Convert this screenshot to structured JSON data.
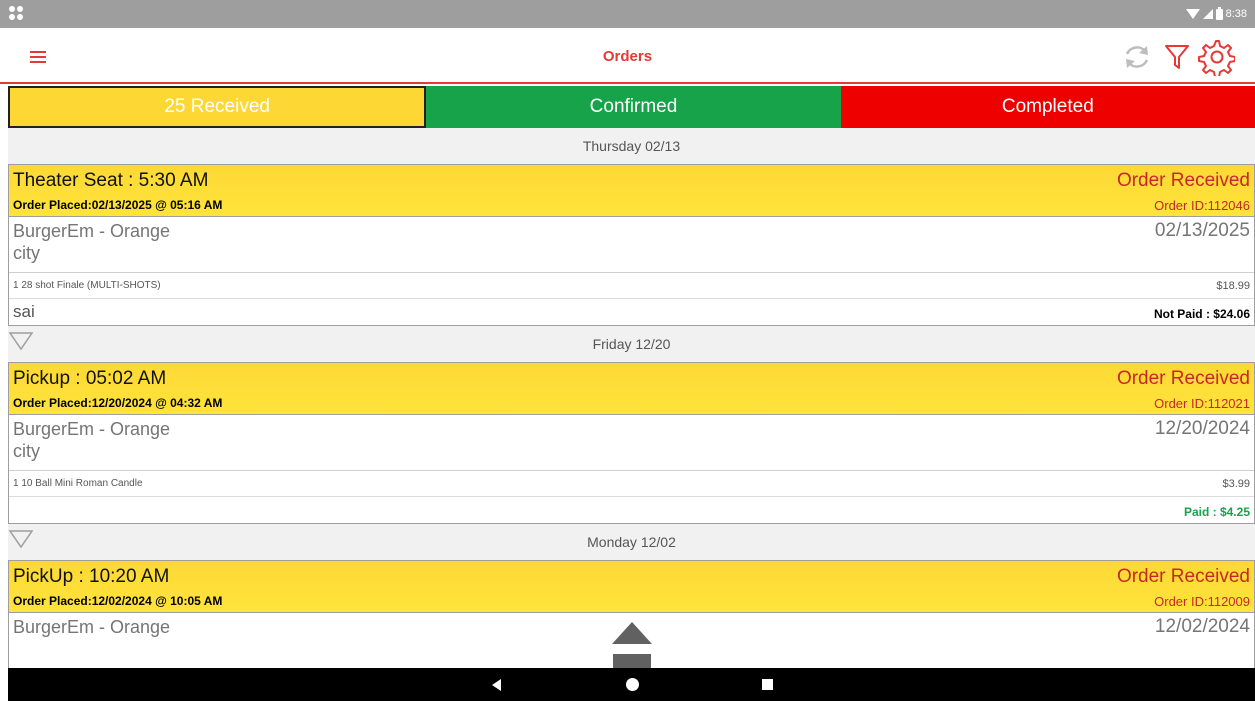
{
  "status_bar": {
    "time": "8:38"
  },
  "app_bar": {
    "title": "Orders"
  },
  "tabs": [
    {
      "label": "25 Received",
      "color": "#fdd835"
    },
    {
      "label": "Confirmed",
      "color": "#17a34a"
    },
    {
      "label": "Completed",
      "color": "#ee0000"
    }
  ],
  "groups": [
    {
      "date": "Thursday 02/13",
      "order": {
        "service": "Theater Seat : 5:30 AM",
        "placed": "Order Placed:02/13/2025 @ 05:16 AM",
        "status": "Order Received",
        "order_id": "Order ID:112046",
        "store_line1": "BurgerEm - Orange",
        "store_line2": "city",
        "order_date": "02/13/2025",
        "item": "1 28 shot Finale (MULTI-SHOTS)",
        "item_price": "$18.99",
        "customer": "sai",
        "payment": "Not Paid : $24.06",
        "payment_color": "#000000"
      }
    },
    {
      "date": "Friday 12/20",
      "order": {
        "service": "Pickup : 05:02 AM",
        "placed": "Order Placed:12/20/2024 @ 04:32 AM",
        "status": "Order Received",
        "order_id": "Order ID:112021",
        "store_line1": "BurgerEm - Orange",
        "store_line2": "city",
        "order_date": "12/20/2024",
        "item": "1 10 Ball Mini Roman Candle",
        "item_price": "$3.99",
        "customer": "",
        "payment": "Paid : $4.25",
        "payment_color": "#17a34a"
      }
    },
    {
      "date": "Monday 12/02",
      "order": {
        "service": "PickUp : 10:20 AM",
        "placed": "Order Placed:12/02/2024 @ 10:05 AM",
        "status": "Order Received",
        "order_id": "Order ID:112009",
        "store_line1": "BurgerEm - Orange",
        "store_line2": "",
        "order_date": "12/02/2024"
      }
    }
  ],
  "colors": {
    "accent": "#e53935",
    "header_yellow": "#fdd835",
    "paid_green": "#17a34a"
  },
  "icons": [
    "menu-icon",
    "refresh-icon",
    "filter-icon",
    "gear-icon",
    "collapse-triangle-icon",
    "scroll-top-icon",
    "back-icon",
    "home-icon",
    "recents-icon"
  ]
}
